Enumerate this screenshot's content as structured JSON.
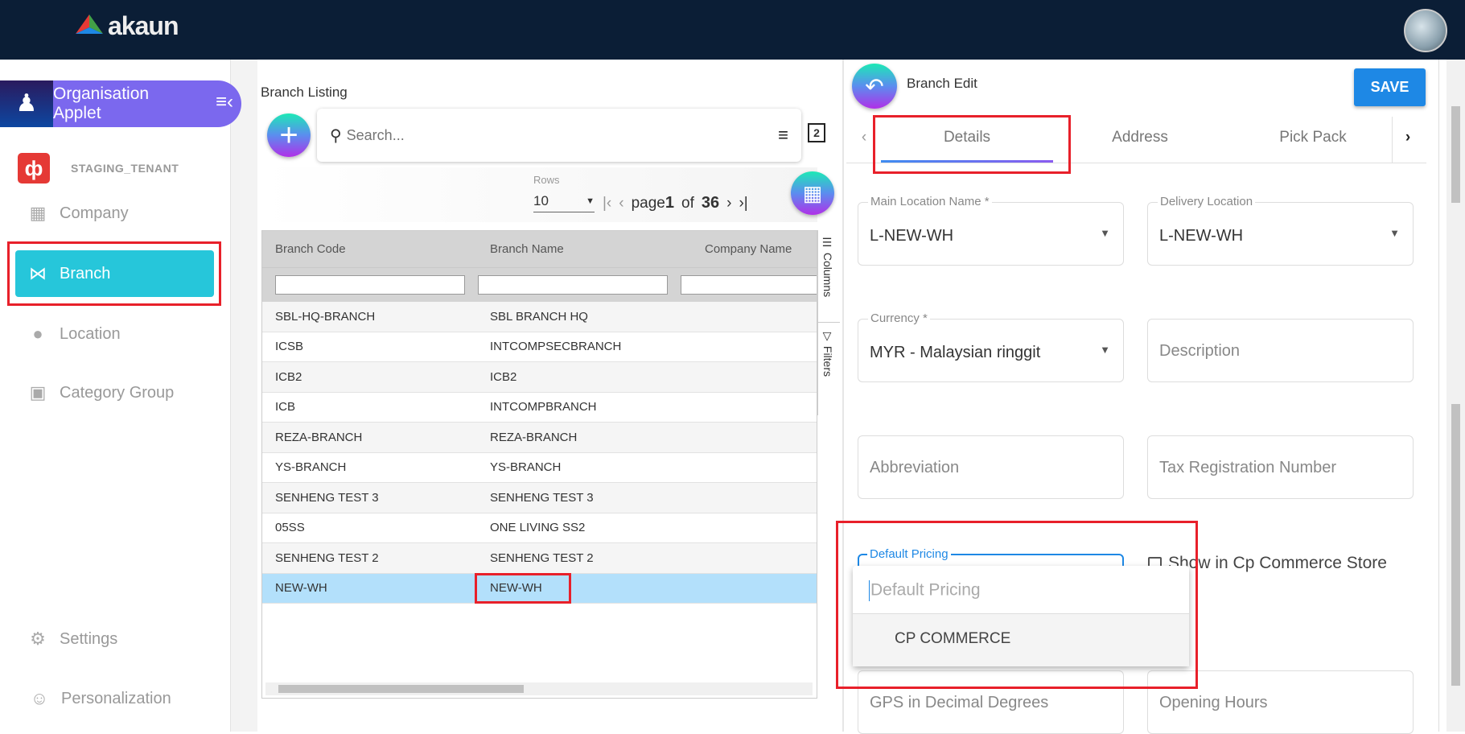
{
  "header": {
    "logo_text": "akaun"
  },
  "sidebar": {
    "applet_title_line1": "Organisation",
    "applet_title_line2": "Applet",
    "tenant": "STAGING_TENANT",
    "items": [
      {
        "label": "Company"
      },
      {
        "label": "Branch"
      },
      {
        "label": "Location"
      },
      {
        "label": "Category Group"
      }
    ],
    "bottom": [
      {
        "label": "Settings"
      },
      {
        "label": "Personalization"
      }
    ]
  },
  "listing": {
    "title": "Branch Listing",
    "search_placeholder": "Search...",
    "copy_badge": "2",
    "rows_label": "Rows",
    "rows_value": "10",
    "page_word": "page",
    "page": "1",
    "of_word": "of",
    "total_pages": "36",
    "columns": [
      "Branch Code",
      "Branch Name",
      "Company Name"
    ],
    "rows": [
      [
        "SBL-HQ-BRANCH",
        "SBL BRANCH HQ"
      ],
      [
        "ICSB",
        "INTCOMPSECBRANCH"
      ],
      [
        "ICB2",
        "ICB2"
      ],
      [
        "ICB",
        "INTCOMPBRANCH"
      ],
      [
        "REZA-BRANCH",
        "REZA-BRANCH"
      ],
      [
        "YS-BRANCH",
        "YS-BRANCH"
      ],
      [
        "SENHENG TEST 3",
        "SENHENG TEST 3"
      ],
      [
        "05SS",
        "ONE LIVING SS2"
      ],
      [
        "SENHENG TEST 2",
        "SENHENG TEST 2"
      ],
      [
        "NEW-WH",
        "NEW-WH"
      ]
    ],
    "side_columns": "Columns",
    "side_filters": "Filters"
  },
  "edit": {
    "title": "Branch Edit",
    "save_label": "SAVE",
    "tabs": [
      "Details",
      "Address",
      "Pick Pack"
    ],
    "fields": {
      "main_location_label": "Main Location Name *",
      "main_location_value": "L-NEW-WH",
      "delivery_label": "Delivery Location",
      "delivery_value": "L-NEW-WH",
      "currency_label": "Currency *",
      "currency_value": "MYR - Malaysian ringgit",
      "description": "Description",
      "abbreviation": "Abbreviation",
      "tax_reg": "Tax Registration Number",
      "default_pricing_label": "Default Pricing",
      "default_pricing_placeholder": "Default Pricing",
      "default_pricing_option": "CP COMMERCE",
      "show_cp": "Show in Cp Commerce Store",
      "gps": "GPS in Decimal Degrees",
      "opening_hours": "Opening Hours"
    }
  }
}
